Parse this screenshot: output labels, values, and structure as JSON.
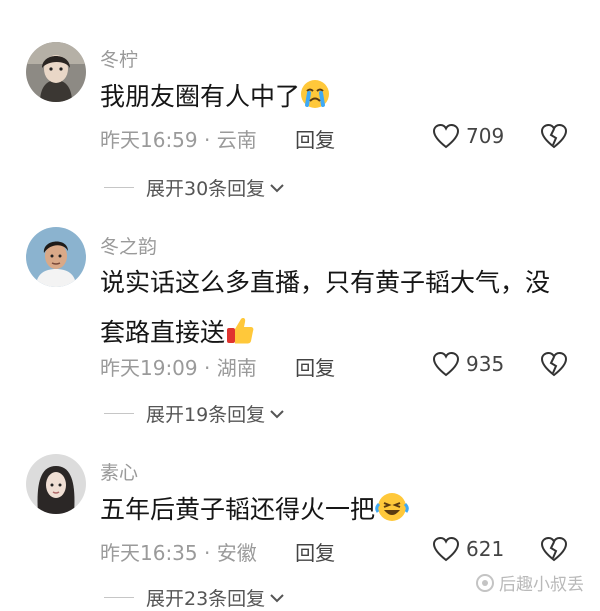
{
  "comments": [
    {
      "username": "冬柠",
      "text": "我朋友圈有人中了",
      "emoji": "crying-face-emoji",
      "time": "昨天16:59",
      "location": "云南",
      "reply_label": "回复",
      "likes": "709",
      "expand_label": "展开30条回复"
    },
    {
      "username": "冬之韵",
      "text": "说实话这么多直播，只有黄子韬大气，没套路直接送",
      "emoji": "thumbs-up-emoji",
      "time": "昨天19:09",
      "location": "湖南",
      "reply_label": "回复",
      "likes": "935",
      "expand_label": "展开19条回复"
    },
    {
      "username": "素心",
      "text": "五年后黄子韬还得火一把",
      "emoji": "laughing-tears-emoji",
      "time": "昨天16:35",
      "location": "安徽",
      "reply_label": "回复",
      "likes": "621",
      "expand_label": "展开23条回复"
    }
  ],
  "separator": "·",
  "watermark": "后趣小叔丢"
}
